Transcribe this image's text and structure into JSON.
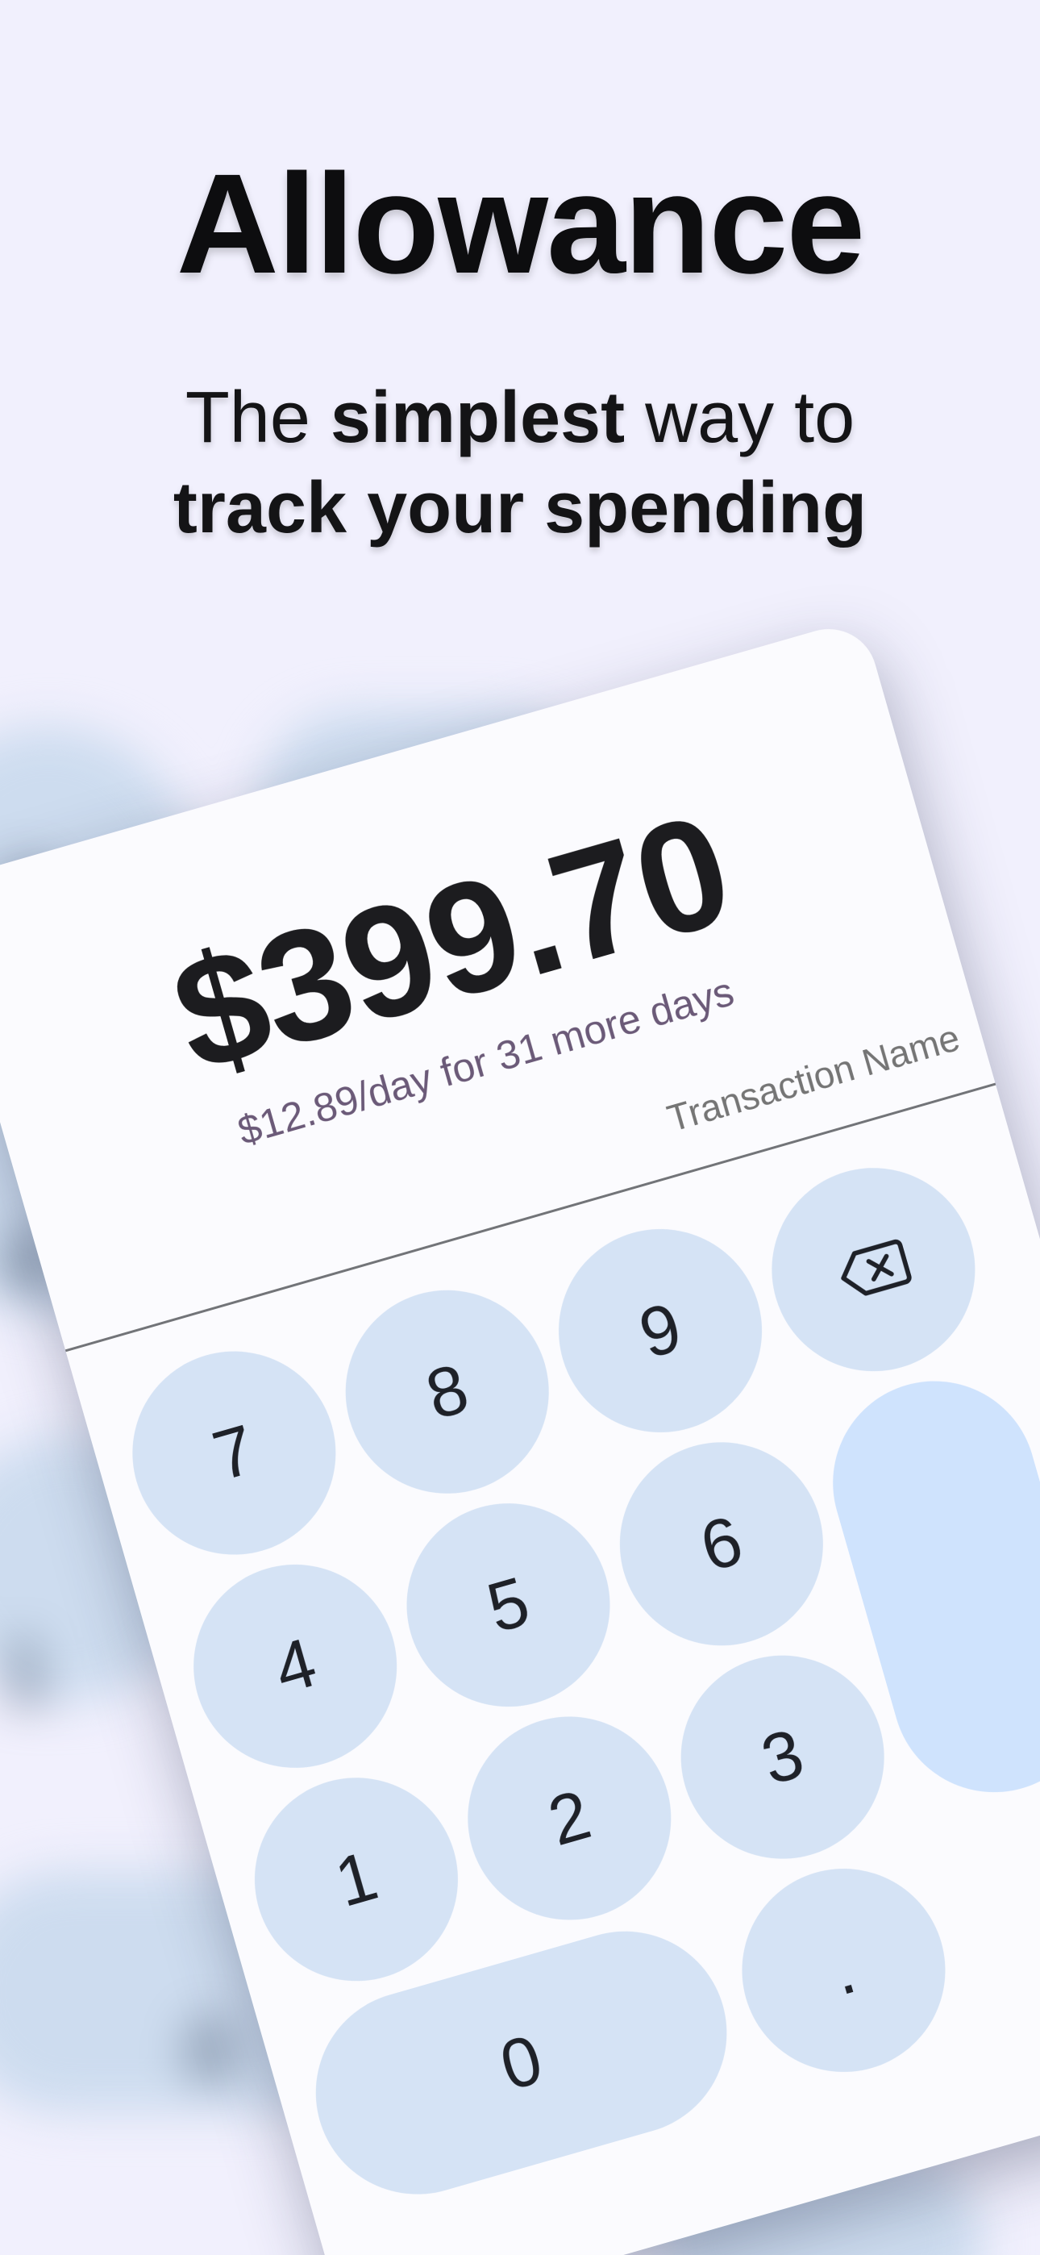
{
  "app": {
    "title": "Allowance"
  },
  "tagline": {
    "line1": {
      "prefix": "The ",
      "emphasis": "simplest",
      "suffix": " way to"
    },
    "line2": "track your spending"
  },
  "balance": {
    "amount": "$399.70",
    "per_day": "$12.89/day for 31 more days"
  },
  "transaction": {
    "placeholder": "Transaction Name"
  },
  "keypad": {
    "keys": [
      "7",
      "8",
      "9",
      "4",
      "5",
      "6",
      "1",
      "2",
      "3",
      "0",
      "."
    ],
    "backspace_icon": "backspace-icon"
  },
  "colors": {
    "background": "#f1f0fd",
    "card": "#fbfbfe",
    "key": "#d5e3f5",
    "accent_key": "#cfe3fd",
    "per_day_text": "#6b5a78",
    "placeholder_text": "#a7abb4"
  }
}
